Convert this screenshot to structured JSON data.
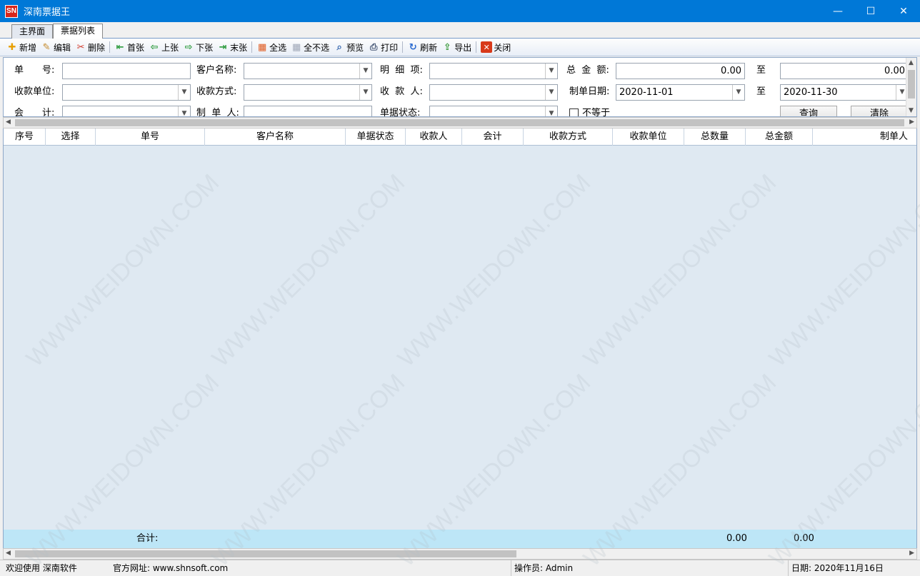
{
  "window": {
    "logo": "SN",
    "title": "深南票据王",
    "minimize": "—",
    "maximize": "☐",
    "close": "✕"
  },
  "tabs": [
    {
      "label": "主界面"
    },
    {
      "label": "票据列表"
    }
  ],
  "toolbar": {
    "new": "新增",
    "edit": "编辑",
    "delete": "删除",
    "first": "首张",
    "prev": "上张",
    "next": "下张",
    "last": "末张",
    "select_all": "全选",
    "select_none": "全不选",
    "preview": "预览",
    "print": "打印",
    "refresh": "刷新",
    "export": "导出",
    "close": "关闭"
  },
  "filter": {
    "doc_no_label": "单　　号:",
    "customer_label": "客户名称:",
    "detail_label": "明  细  项:",
    "total_amount_label": "总  金  额:",
    "amount_from": "0.00",
    "to_label": "至",
    "amount_to": "0.00",
    "receipt_unit_label": "收款单位:",
    "payment_method_label": "收款方式:",
    "payee_label": "收  款  人:",
    "create_date_label": "制单日期:",
    "date_from": "2020-11-01",
    "date_to": "2020-11-30",
    "accountant_label": "会　　计:",
    "creator_label": "制  单  人:",
    "status_label": "单据状态:",
    "not_equal_label": "不等于",
    "query_button": "查询",
    "clear_button": "清除"
  },
  "grid": {
    "columns": [
      "序号",
      "选择",
      "单号",
      "客户名称",
      "单据状态",
      "收款人",
      "会计",
      "收款方式",
      "收款单位",
      "总数量",
      "总金额",
      "制单人"
    ],
    "rows": []
  },
  "footer": {
    "total_label": "合计:",
    "total_quantity": "0.00",
    "total_amount": "0.00"
  },
  "status": {
    "welcome": "欢迎使用 深南软件",
    "website": "官方网址: www.shnsoft.com",
    "operator": "操作员: Admin",
    "date": "日期: 2020年11月16日"
  },
  "watermark": "WWW.WEIDOWN.COM",
  "colors": {
    "titlebar": "#0078d7",
    "grid_bg": "#dfe9f2",
    "footer_bg": "#bde6f7"
  }
}
